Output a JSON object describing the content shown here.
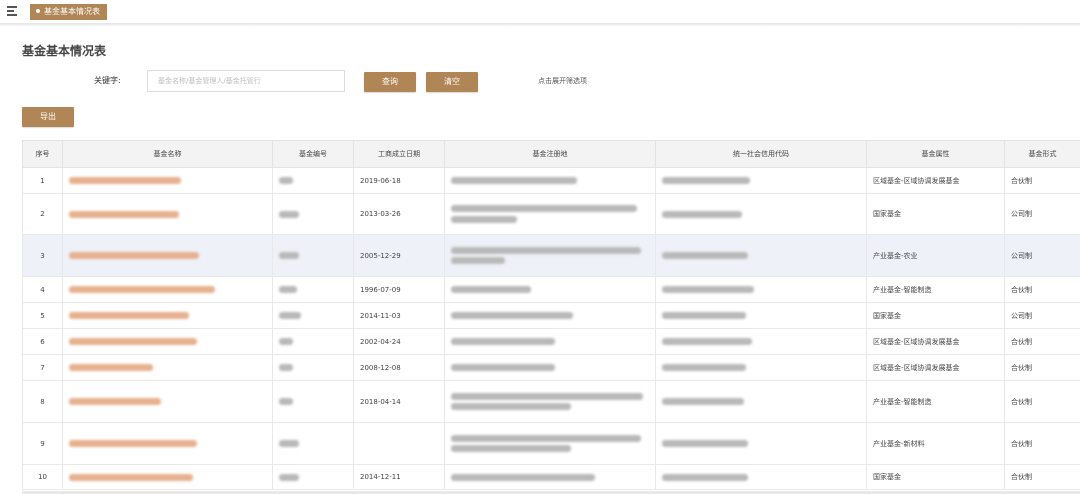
{
  "topbar": {
    "tab_label": "基金基本情况表"
  },
  "page": {
    "title": "基金基本情况表"
  },
  "filter": {
    "keyword_label": "关键字:",
    "search_placeholder": "基金名称/基金管理人/基金托管行",
    "search_button": "查询",
    "clear_button": "清空",
    "expand_link": "点击展开筛选项"
  },
  "toolbar": {
    "export_button": "导出"
  },
  "table": {
    "headers": [
      "序号",
      "基金名称",
      "基金编号",
      "工商成立日期",
      "基金注册地",
      "统一社会信用代码",
      "基金属性",
      "基金形式"
    ],
    "rows": [
      {
        "idx": "1",
        "date": "2019-06-18",
        "attr": "区域基金-区域协调发展基金",
        "form": "合伙制"
      },
      {
        "idx": "2",
        "date": "2013-03-26",
        "attr": "国家基金",
        "form": "公司制"
      },
      {
        "idx": "3",
        "date": "2005-12-29",
        "attr": "产业基金-农业",
        "form": "公司制"
      },
      {
        "idx": "4",
        "date": "1996-07-09",
        "attr": "产业基金-智能制造",
        "form": "合伙制"
      },
      {
        "idx": "5",
        "date": "2014-11-03",
        "attr": "国家基金",
        "form": "公司制"
      },
      {
        "idx": "6",
        "date": "2002-04-24",
        "attr": "区域基金-区域协调发展基金",
        "form": "合伙制"
      },
      {
        "idx": "7",
        "date": "2008-12-08",
        "attr": "区域基金-区域协调发展基金",
        "form": "合伙制"
      },
      {
        "idx": "8",
        "date": "2018-04-14",
        "attr": "产业基金-智能制造",
        "form": "合伙制"
      },
      {
        "idx": "9",
        "date": "",
        "attr": "产业基金-新材料",
        "form": "合伙制"
      },
      {
        "idx": "10",
        "date": "2014-12-11",
        "attr": "国家基金",
        "form": "合伙制"
      }
    ]
  }
}
